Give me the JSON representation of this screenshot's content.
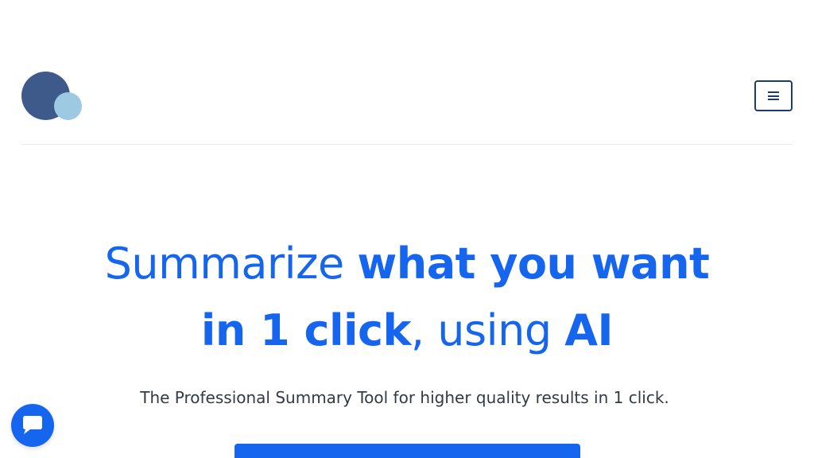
{
  "colors": {
    "accent": "#1565ee",
    "logo_dark": "#3d5a8a",
    "logo_light": "#9ec9e2",
    "menu_border": "#1a3c6e",
    "divider": "#e8ecf1",
    "text": "#333a45"
  },
  "header": {
    "logo_icon": "two-circles-logo",
    "menu_icon": "hamburger-menu-icon"
  },
  "hero": {
    "part1": "Summarize ",
    "part2": "what you want in 1 click",
    "part3": ", using ",
    "part4": "AI"
  },
  "subtitle": "The Professional Summary Tool for higher quality results in 1 click.",
  "chat": {
    "icon": "chat-bubble-icon"
  }
}
